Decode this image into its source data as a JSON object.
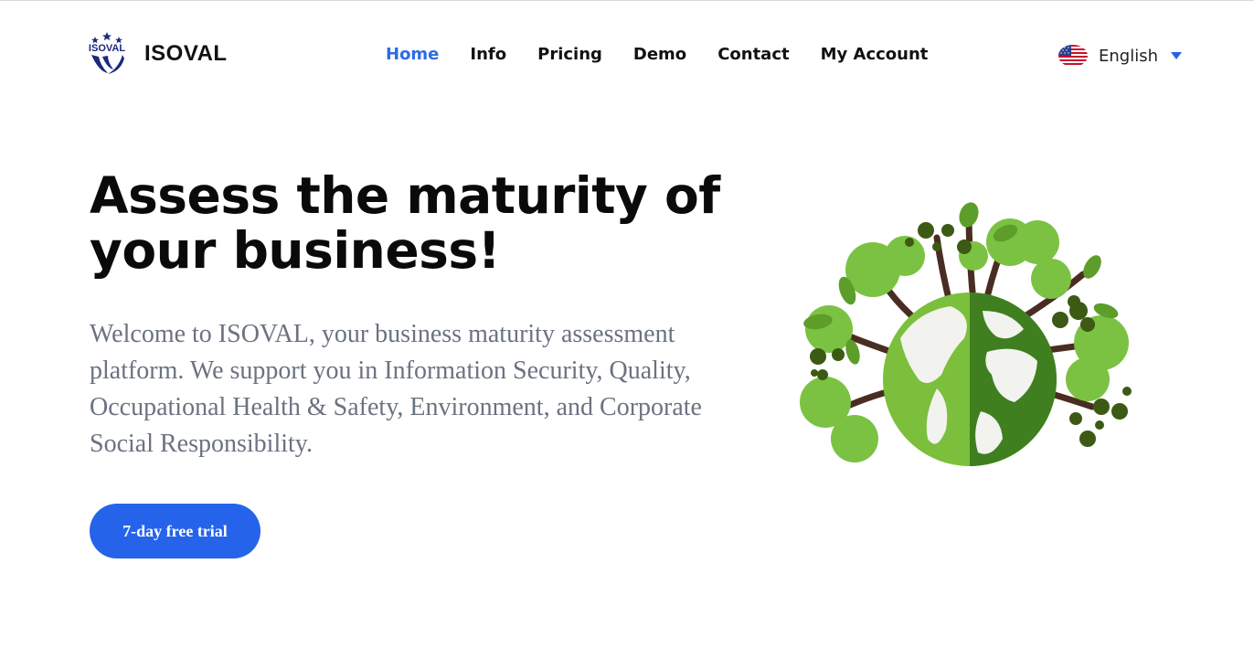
{
  "brand": {
    "logo_text": "ISOVAL",
    "name": "ISOVAL"
  },
  "nav": {
    "items": [
      {
        "label": "Home",
        "active": true
      },
      {
        "label": "Info",
        "active": false
      },
      {
        "label": "Pricing",
        "active": false
      },
      {
        "label": "Demo",
        "active": false
      },
      {
        "label": "Contact",
        "active": false
      },
      {
        "label": "My Account",
        "active": false
      }
    ]
  },
  "language": {
    "selected": "English",
    "flag_icon": "us-flag-icon",
    "dropdown_icon": "caret-down-icon"
  },
  "hero": {
    "title": "Assess the maturity of your business!",
    "description": "Welcome to ISOVAL, your business maturity assessment platform. We support you in Information Security, Quality, Occupational Health & Safety, Environment, and Corporate Social Responsibility.",
    "cta_label": "7-day free trial",
    "illustration_icon": "green-earth-trees-illustration"
  },
  "colors": {
    "accent": "#2563eb",
    "nav_active": "#2d6be4",
    "text_muted": "#6b7280",
    "leaf_light": "#7cc242",
    "leaf_dark": "#3c7a1f"
  }
}
